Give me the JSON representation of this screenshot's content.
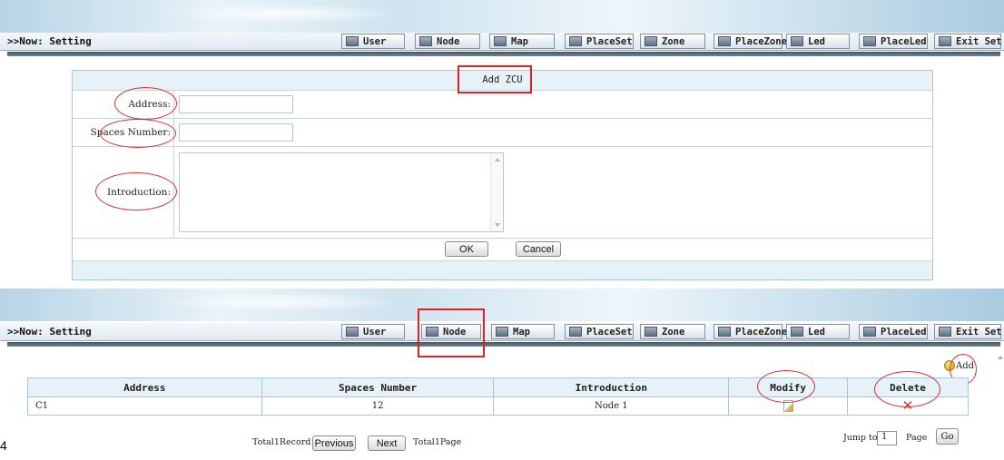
{
  "header": {
    "now_label": ">>Now: Setting",
    "menu": [
      {
        "label": "User"
      },
      {
        "label": "Node"
      },
      {
        "label": "Map"
      },
      {
        "label": "PlaceSet"
      },
      {
        "label": "Zone"
      },
      {
        "label": "PlaceZone"
      },
      {
        "label": "Led"
      },
      {
        "label": "PlaceLed"
      },
      {
        "label": "Exit Set"
      }
    ]
  },
  "form": {
    "title": "Add ZCU",
    "fields": [
      {
        "label": "Address:",
        "value": ""
      },
      {
        "label": "Spaces Number:",
        "value": ""
      },
      {
        "label": "Introduction:",
        "value": ""
      }
    ],
    "ok_label": "OK",
    "cancel_label": "Cancel"
  },
  "list": {
    "add_label": "Add",
    "columns": [
      "Address",
      "Spaces Number",
      "Introduction",
      "Modify",
      "Delete"
    ],
    "rows": [
      {
        "address": "C1",
        "spaces": "12",
        "intro": "Node 1"
      }
    ],
    "pagination": {
      "total_record": "Total1Record",
      "previous": "Previous",
      "next": "Next",
      "total_page": "Total1Page",
      "jump_to": "Jump to",
      "page_value": "1",
      "page_label": "Page",
      "go": "Go"
    }
  },
  "page_number": "4",
  "colors": {
    "annotation": "#e02020",
    "header_bg": "#e6f1f8",
    "border": "#a9c6d8"
  }
}
